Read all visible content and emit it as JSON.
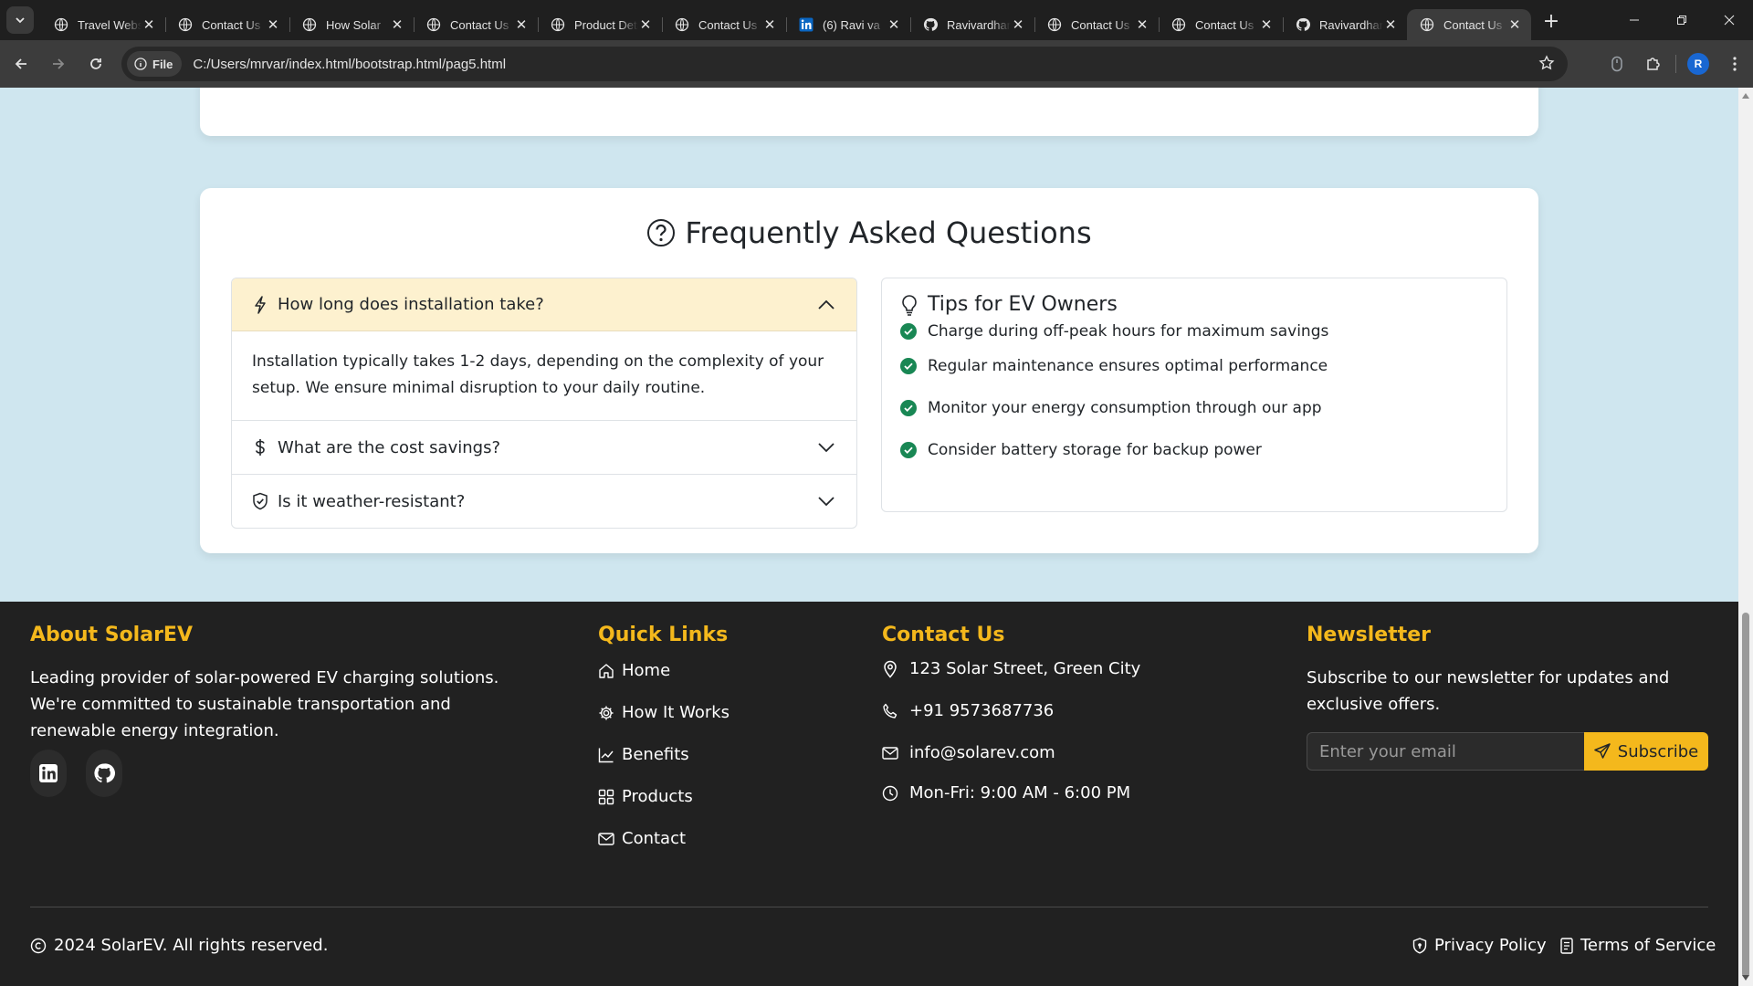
{
  "browser": {
    "tabs": [
      {
        "title": "Travel Website",
        "icon": "globe-icon"
      },
      {
        "title": "Contact Us",
        "icon": "globe-icon"
      },
      {
        "title": "How Solar",
        "icon": "globe-icon"
      },
      {
        "title": "Contact Us",
        "icon": "globe-icon"
      },
      {
        "title": "Product Details",
        "icon": "globe-icon"
      },
      {
        "title": "Contact Us",
        "icon": "globe-icon"
      },
      {
        "title": "(6) Ravi va",
        "icon": "linkedin-icon"
      },
      {
        "title": "Ravivardhan",
        "icon": "github-icon"
      },
      {
        "title": "Contact Us",
        "icon": "globe-icon"
      },
      {
        "title": "Contact Us",
        "icon": "globe-icon"
      },
      {
        "title": "Ravivardhan",
        "icon": "github-icon"
      },
      {
        "title": "Contact Us",
        "icon": "globe-icon",
        "active": true
      }
    ],
    "file_chip": "File",
    "url": "C:/Users/mrvar/index.html/bootstrap.html/pag5.html",
    "profile_initial": "R"
  },
  "faq": {
    "title": "Frequently Asked Questions",
    "items": [
      {
        "question": "How long does installation take?",
        "answer": "Installation typically takes 1-2 days, depending on the complexity of your setup. We ensure minimal disruption to your daily routine.",
        "icon": "lightning-icon",
        "open": true
      },
      {
        "question": "What are the cost savings?",
        "icon": "dollar-icon",
        "open": false
      },
      {
        "question": "Is it weather-resistant?",
        "icon": "shield-check-icon",
        "open": false
      }
    ]
  },
  "tips": {
    "title": "Tips for EV Owners",
    "items": [
      "Charge during off-peak hours for maximum savings",
      "Regular maintenance ensures optimal performance",
      "Monitor your energy consumption through our app",
      "Consider battery storage for backup power"
    ]
  },
  "footer": {
    "about": {
      "heading": "About SolarEV",
      "text": "Leading provider of solar-powered EV charging solutions. We're committed to sustainable transportation and renewable energy integration."
    },
    "quick_links": {
      "heading": "Quick Links",
      "items": [
        "Home",
        "How It Works",
        "Benefits",
        "Products",
        "Contact"
      ]
    },
    "contact": {
      "heading": "Contact Us",
      "address": "123 Solar Street, Green City",
      "phone": "+91 9573687736",
      "email": "info@solarev.com",
      "hours": "Mon-Fri: 9:00 AM - 6:00 PM"
    },
    "newsletter": {
      "heading": "Newsletter",
      "text": "Subscribe to our newsletter for updates and exclusive offers.",
      "placeholder": "Enter your email",
      "button": "Subscribe"
    },
    "copyright": "2024 SolarEV. All rights reserved.",
    "privacy": "Privacy Policy",
    "terms": "Terms of Service"
  },
  "colors": {
    "accent": "#f4b81c",
    "footer_bg": "#212121",
    "page_bg": "#cfe6ef",
    "success": "#198754"
  }
}
